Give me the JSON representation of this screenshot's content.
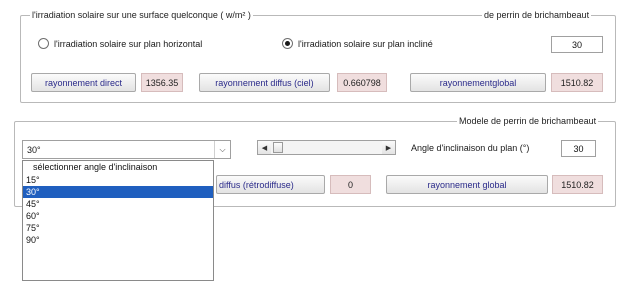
{
  "panel1": {
    "legend_left": "l'irradiation solaire sur une surface quelconque ( w/m² )",
    "legend_right": "de perrin de brichambeaut",
    "radio_horizontal": "l'irradiation solaire sur plan horizontal",
    "radio_incline": "l'irradiation solaire sur plan incliné",
    "selected_radio": "incline",
    "angle_value": "30",
    "btn_direct": "rayonnement direct",
    "val_direct": "1356.35",
    "btn_diffus": "rayonnement diffus (ciel)",
    "val_diffus": "0.660798",
    "btn_global": "rayonnementglobal",
    "val_global": "1510.82"
  },
  "panel2": {
    "legend_right": "Modele de perrin de brichambeaut",
    "combo_value": "30°",
    "angle_label": "Angle d'inclinaison du plan (°)",
    "angle_value": "30",
    "btn_retro": "diffus (rétrodiffuse)",
    "val_retro": "0",
    "btn_global": "rayonnement global",
    "val_global": "1510.82",
    "slider_fraction": 0.05
  },
  "dropdown": {
    "header": "sélectionner angle d'inclinaison",
    "options": [
      "15°",
      "30°",
      "45°",
      "60°",
      "75°",
      "90°"
    ],
    "selected": "30°"
  },
  "colors": {
    "value_bg": "#f0dede",
    "selection": "#1f5fbf",
    "button_text": "#2a2a8a"
  }
}
